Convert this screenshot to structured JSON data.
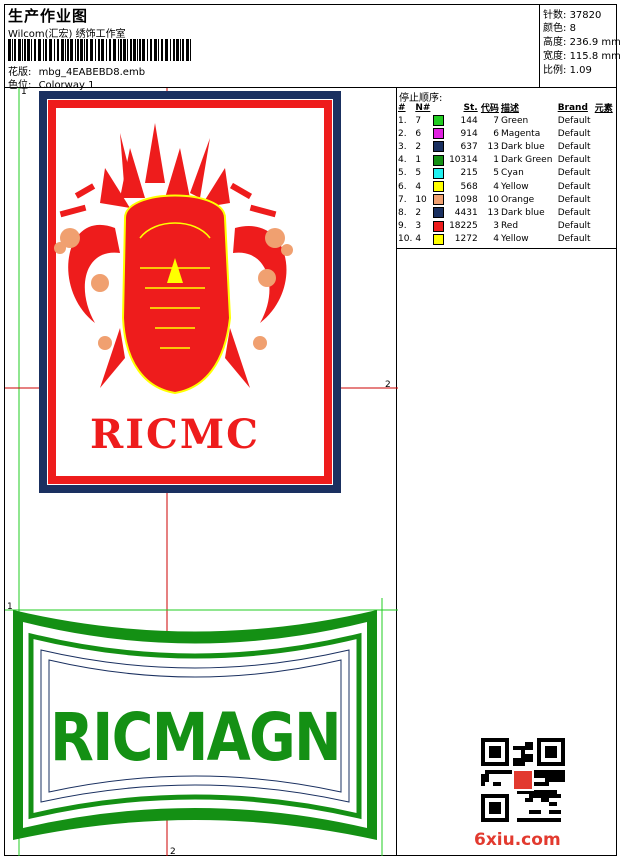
{
  "header": {
    "title": "生产作业图",
    "company": "Wilcom(汇宏) 绣饰工作室",
    "design_label": "花版:",
    "design_value": "mbg_4EABEBD8.emb",
    "colorway_label": "色位:",
    "colorway_value": "Colorway 1"
  },
  "stats": [
    {
      "label": "针数:",
      "value": "37820"
    },
    {
      "label": "颜色:",
      "value": "8"
    },
    {
      "label": "高度:",
      "value": "236.9 mm"
    },
    {
      "label": "宽度:",
      "value": "115.8 mm"
    },
    {
      "label": "比例:",
      "value": "1.09"
    }
  ],
  "stop_sequence": {
    "title": "停止顺序:",
    "columns": [
      "#",
      "N#",
      "St.",
      "代码",
      "描述",
      "Brand",
      "元素"
    ],
    "rows": [
      {
        "idx": "1.",
        "n": "7",
        "st": "144",
        "code": "7",
        "desc": "Green",
        "brand": "Default",
        "color": "#22cc22"
      },
      {
        "idx": "2.",
        "n": "6",
        "st": "914",
        "code": "6",
        "desc": "Magenta",
        "brand": "Default",
        "color": "#e020e0"
      },
      {
        "idx": "3.",
        "n": "2",
        "st": "637",
        "code": "13",
        "desc": "Dark blue",
        "brand": "Default",
        "color": "#1a3060"
      },
      {
        "idx": "4.",
        "n": "1",
        "st": "10314",
        "code": "1",
        "desc": "Dark Green",
        "brand": "Default",
        "color": "#149014"
      },
      {
        "idx": "5.",
        "n": "5",
        "st": "215",
        "code": "5",
        "desc": "Cyan",
        "brand": "Default",
        "color": "#20f0f0"
      },
      {
        "idx": "6.",
        "n": "4",
        "st": "568",
        "code": "4",
        "desc": "Yellow",
        "brand": "Default",
        "color": "#ffff00"
      },
      {
        "idx": "7.",
        "n": "10",
        "st": "1098",
        "code": "10",
        "desc": "Orange",
        "brand": "Default",
        "color": "#f0a070"
      },
      {
        "idx": "8.",
        "n": "2",
        "st": "4431",
        "code": "13",
        "desc": "Dark blue",
        "brand": "Default",
        "color": "#1a3060"
      },
      {
        "idx": "9.",
        "n": "3",
        "st": "18225",
        "code": "3",
        "desc": "Red",
        "brand": "Default",
        "color": "#ee1c1c"
      },
      {
        "idx": "10.",
        "n": "4",
        "st": "1272",
        "code": "4",
        "desc": "Yellow",
        "brand": "Default",
        "color": "#ffff00"
      }
    ]
  },
  "canvas": {
    "top_patch_text": "RICMC",
    "bottom_patch_text": "RICMAGN",
    "marker_1": "1",
    "marker_2": "2",
    "colors": {
      "red": "#ee1c1c",
      "navy": "#1a3060",
      "green": "#149014",
      "yellow": "#ffff00",
      "orange": "#f0a070",
      "guide_green": "#22cc22",
      "guide_red": "#cc0000"
    }
  },
  "watermark": "6xiu.com"
}
